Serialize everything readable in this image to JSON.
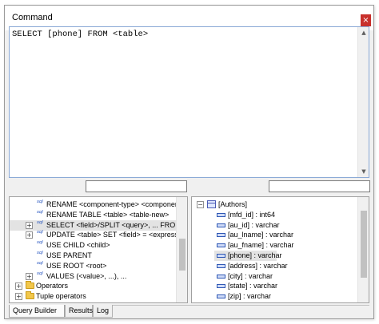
{
  "window": {
    "title": "Command",
    "close_glyph": "×"
  },
  "editor": {
    "text": "SELECT [phone] FROM <table>",
    "scroll_up_glyph": "▲",
    "scroll_down_glyph": "▼"
  },
  "filters": {
    "left_value": "",
    "right_value": ""
  },
  "left_tree": {
    "sql_badge": "sql",
    "items": [
      {
        "label": "RENAME <component-type> <component...",
        "kind": "sql",
        "expander": ""
      },
      {
        "label": "RENAME TABLE <table> <table-new>",
        "kind": "sql",
        "expander": ""
      },
      {
        "label": "SELECT <field>/SPLIT <query>, ... FROM...",
        "kind": "sql",
        "expander": "+",
        "highlighted": true
      },
      {
        "label": "UPDATE <table> SET <field> = <expressi...",
        "kind": "sql",
        "expander": "+"
      },
      {
        "label": "USE CHILD <child>",
        "kind": "sql",
        "expander": ""
      },
      {
        "label": "USE PARENT",
        "kind": "sql",
        "expander": ""
      },
      {
        "label": "USE ROOT <root>",
        "kind": "sql",
        "expander": ""
      },
      {
        "label": "VALUES (<value>, ...), ...",
        "kind": "sql",
        "expander": "+"
      },
      {
        "label": "Operators",
        "kind": "folder",
        "expander": "+"
      },
      {
        "label": "Tuple operators",
        "kind": "folder",
        "expander": "+"
      }
    ]
  },
  "right_tree": {
    "root": {
      "label": "[Authors]",
      "expander": "−"
    },
    "fields": [
      {
        "label": "[mfd_id] : int64"
      },
      {
        "label": "[au_id] : varchar"
      },
      {
        "label": "[au_lname] : varchar"
      },
      {
        "label": "[au_fname] : varchar"
      },
      {
        "label": "[phone] : varchar",
        "highlighted": true
      },
      {
        "label": "[address] : varchar"
      },
      {
        "label": "[city] : varchar"
      },
      {
        "label": "[state] : varchar"
      },
      {
        "label": "[zip] : varchar"
      }
    ]
  },
  "tabs": [
    {
      "label": "Query Builder",
      "active": true
    },
    {
      "label": "Results",
      "active": false
    },
    {
      "label": "Log",
      "active": false
    }
  ],
  "colors": {
    "close_button": "#c8302c",
    "editor_border": "#8aa9d6",
    "sql_icon": "#1f4fbd",
    "folder": "#f2c74b"
  },
  "icons": {
    "close": "close-icon",
    "sql": "sql-icon",
    "folder": "folder-icon",
    "table": "table-icon",
    "field": "field-icon"
  }
}
